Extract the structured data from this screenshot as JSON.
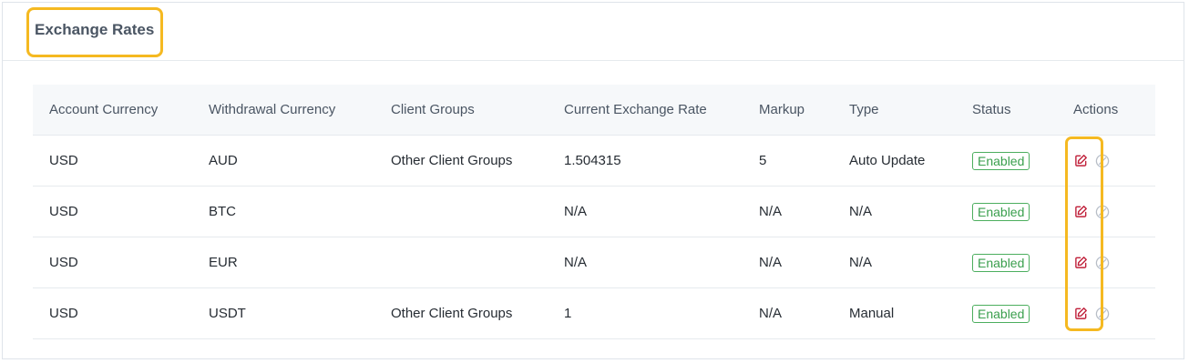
{
  "page": {
    "title": "Exchange Rates"
  },
  "table": {
    "headers": [
      "Account Currency",
      "Withdrawal Currency",
      "Client Groups",
      "Current Exchange Rate",
      "Markup",
      "Type",
      "Status",
      "Actions"
    ],
    "rows": [
      {
        "account_currency": "USD",
        "withdrawal_currency": "AUD",
        "client_groups": "Other Client Groups",
        "rate": "1.504315",
        "markup": "5",
        "type": "Auto Update",
        "status": "Enabled"
      },
      {
        "account_currency": "USD",
        "withdrawal_currency": "BTC",
        "client_groups": "",
        "rate": "N/A",
        "markup": "N/A",
        "type": "N/A",
        "status": "Enabled"
      },
      {
        "account_currency": "USD",
        "withdrawal_currency": "EUR",
        "client_groups": "",
        "rate": "N/A",
        "markup": "N/A",
        "type": "N/A",
        "status": "Enabled"
      },
      {
        "account_currency": "USD",
        "withdrawal_currency": "USDT",
        "client_groups": "Other Client Groups",
        "rate": "1",
        "markup": "N/A",
        "type": "Manual",
        "status": "Enabled"
      }
    ]
  },
  "icons": {
    "edit": "edit-icon",
    "disable": "disable-icon"
  },
  "colors": {
    "highlight": "#f5b921",
    "edit_icon": "#c0203a",
    "enabled_badge": "#3a9f4d",
    "disable_icon": "#b8bec6"
  }
}
